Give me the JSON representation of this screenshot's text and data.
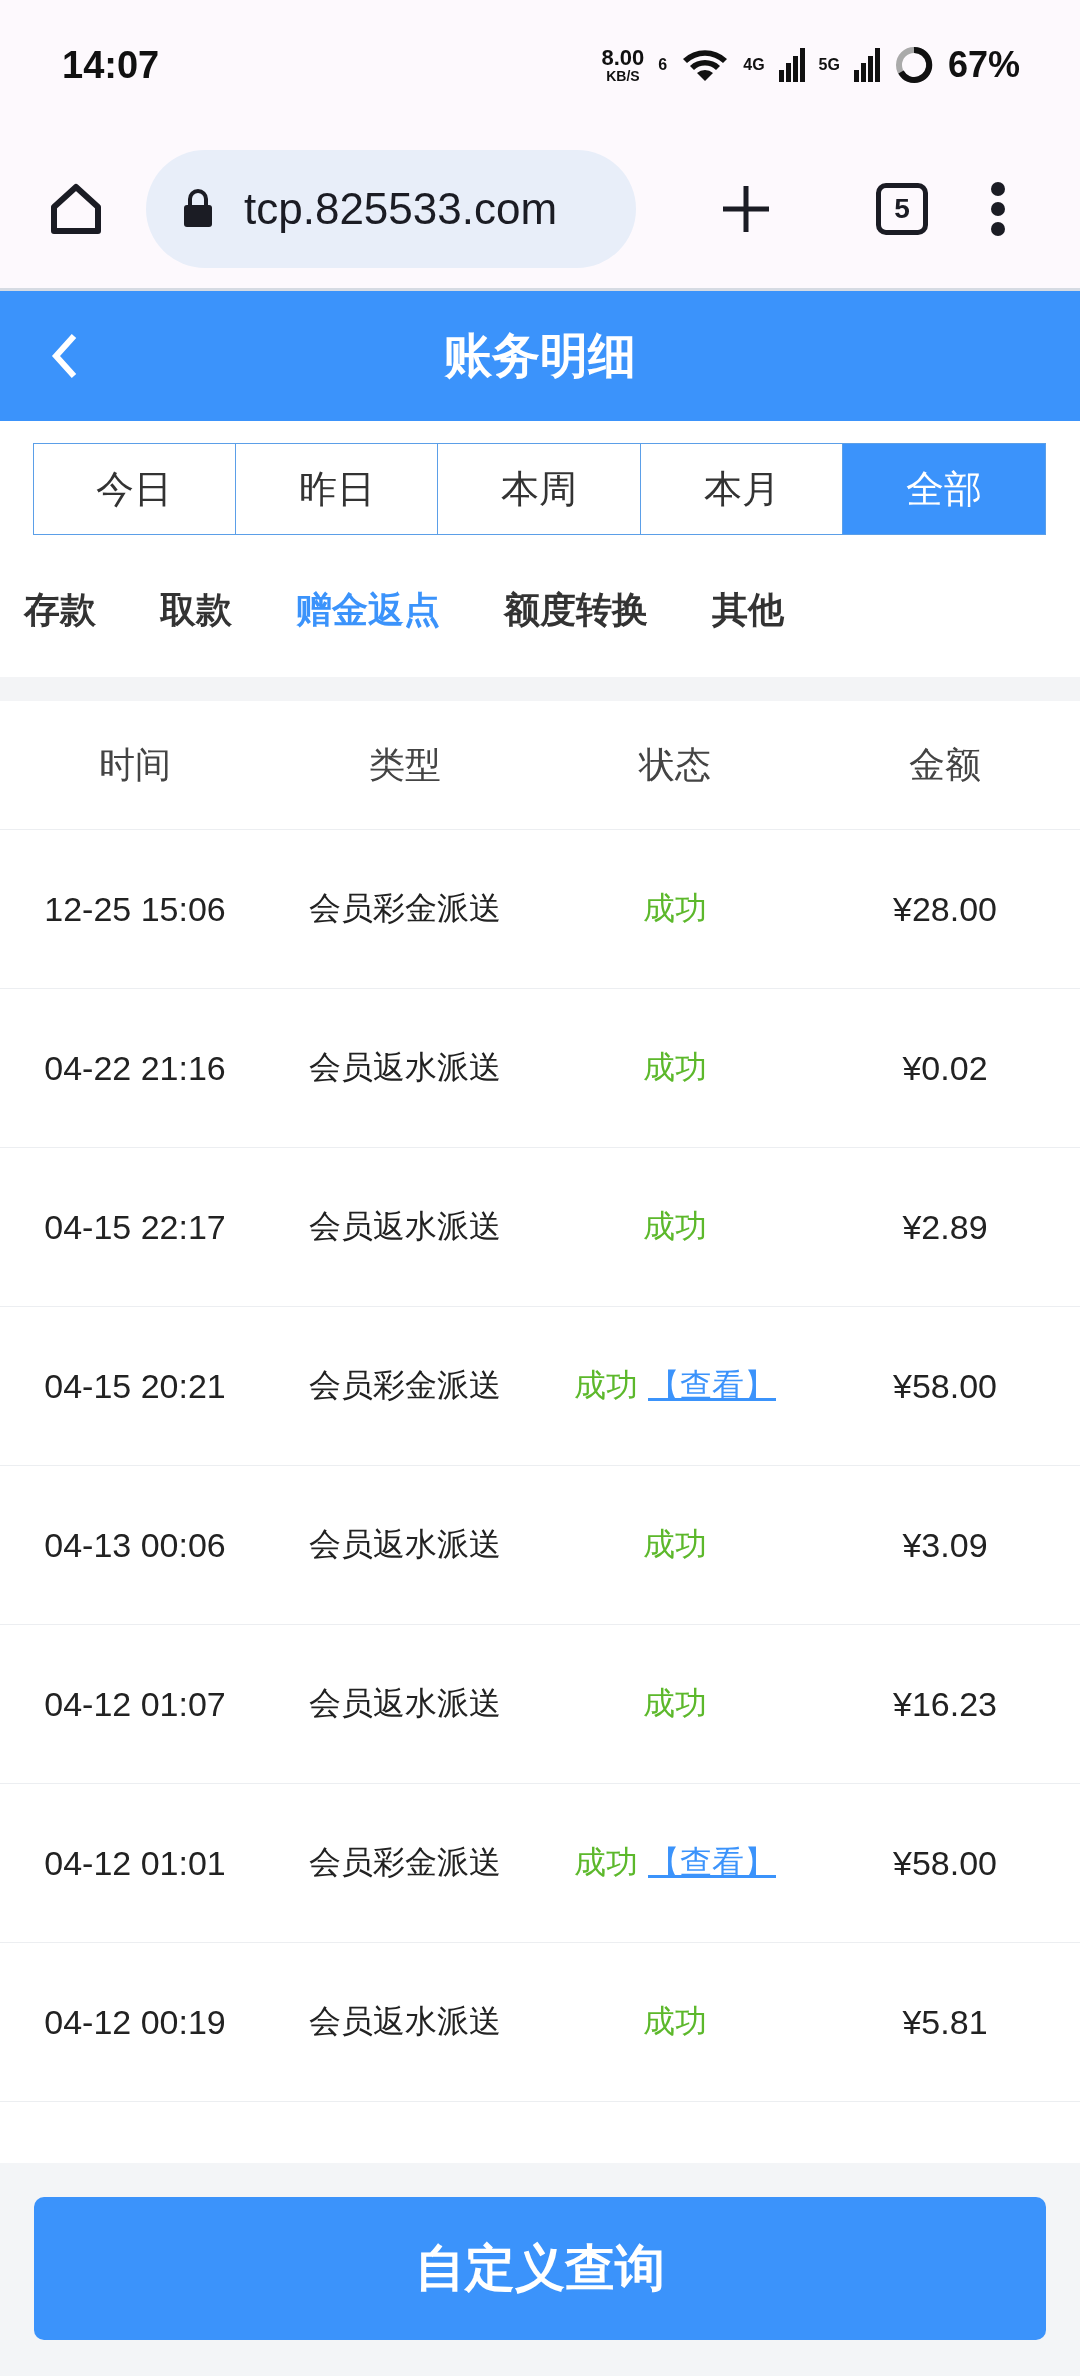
{
  "status_bar": {
    "time": "14:07",
    "speed": "8.00",
    "speed_unit": "KB/S",
    "wifi_label": "6",
    "net1": "4G",
    "net2": "5G",
    "battery": "67%"
  },
  "browser": {
    "url": "tcp.825533.com",
    "tab_count": "5"
  },
  "header": {
    "title": "账务明细"
  },
  "periods": [
    {
      "label": "今日",
      "selected": false
    },
    {
      "label": "昨日",
      "selected": false
    },
    {
      "label": "本周",
      "selected": false
    },
    {
      "label": "本月",
      "selected": false
    },
    {
      "label": "全部",
      "selected": true
    }
  ],
  "categories": [
    {
      "label": "存款",
      "selected": false
    },
    {
      "label": "取款",
      "selected": false
    },
    {
      "label": "赠金返点",
      "selected": true
    },
    {
      "label": "额度转换",
      "selected": false
    },
    {
      "label": "其他",
      "selected": false
    }
  ],
  "table": {
    "columns": [
      "时间",
      "类型",
      "状态",
      "金额"
    ],
    "rows": [
      {
        "time": "12-25 15:06",
        "type": "会员彩金派送",
        "status": "成功",
        "amount": "¥28.00"
      },
      {
        "time": "04-22 21:16",
        "type": "会员返水派送",
        "status": "成功",
        "amount": "¥0.02"
      },
      {
        "time": "04-15 22:17",
        "type": "会员返水派送",
        "status": "成功",
        "amount": "¥2.89"
      },
      {
        "time": "04-15 20:21",
        "type": "会员彩金派送",
        "status": "成功",
        "link": "【查看】",
        "amount": "¥58.00"
      },
      {
        "time": "04-13 00:06",
        "type": "会员返水派送",
        "status": "成功",
        "amount": "¥3.09"
      },
      {
        "time": "04-12 01:07",
        "type": "会员返水派送",
        "status": "成功",
        "amount": "¥16.23"
      },
      {
        "time": "04-12 01:01",
        "type": "会员彩金派送",
        "status": "成功",
        "link": "【查看】",
        "amount": "¥58.00"
      },
      {
        "time": "04-12 00:19",
        "type": "会员返水派送",
        "status": "成功",
        "amount": "¥5.81"
      }
    ]
  },
  "query_button": "自定义查询"
}
